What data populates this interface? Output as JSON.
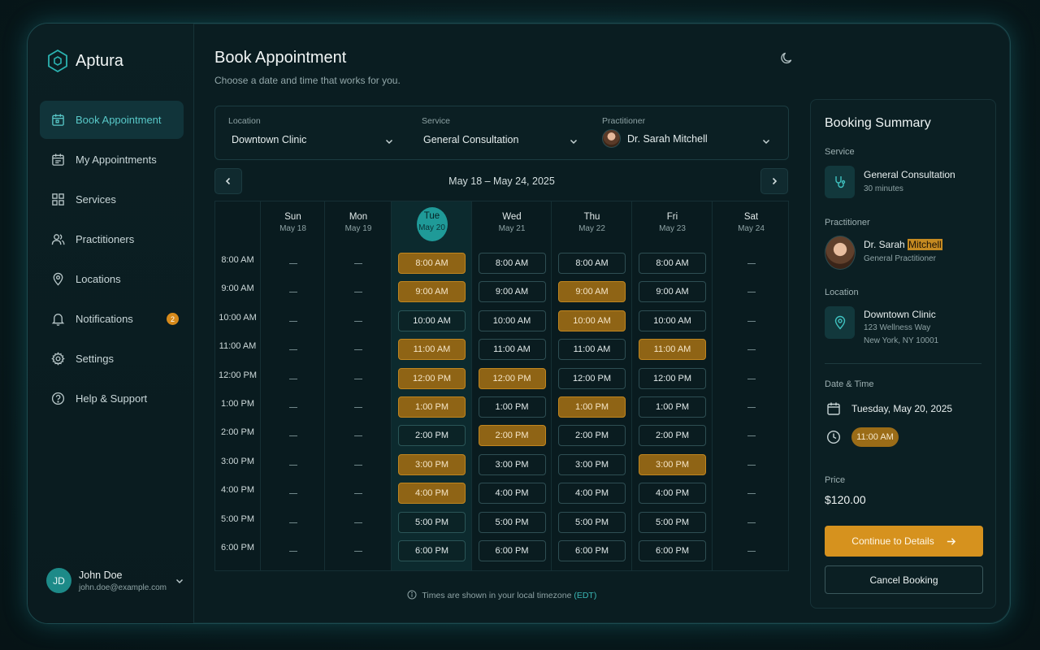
{
  "app": {
    "name": "Aptura"
  },
  "sidebar": {
    "items": [
      {
        "label": "Book Appointment",
        "icon": "calendar-icon",
        "active": true
      },
      {
        "label": "My Appointments",
        "icon": "calendar-check-icon"
      },
      {
        "label": "Services",
        "icon": "grid-icon"
      },
      {
        "label": "Practitioners",
        "icon": "users-icon"
      },
      {
        "label": "Locations",
        "icon": "map-pin-icon"
      },
      {
        "label": "Notifications",
        "icon": "bell-icon",
        "badge": "2"
      },
      {
        "label": "Settings",
        "icon": "gear-icon"
      },
      {
        "label": "Help & Support",
        "icon": "help-circle-icon"
      }
    ],
    "user": {
      "initials": "JD",
      "name": "John Doe",
      "email": "john.doe@example.com"
    }
  },
  "header": {
    "title": "Book Appointment",
    "subtitle": "Choose a date and time that works for you."
  },
  "filters": {
    "location": {
      "label": "Location",
      "value": "Downtown Clinic"
    },
    "service": {
      "label": "Service",
      "value": "General Consultation"
    },
    "practitioner": {
      "label": "Practitioner",
      "value": "Dr. Sarah Mitchell"
    }
  },
  "calendar": {
    "week_label": "May 18 – May 24, 2025",
    "days": [
      {
        "name": "Sun",
        "date": "May 18"
      },
      {
        "name": "Mon",
        "date": "May 19"
      },
      {
        "name": "Tue",
        "date": "May 20",
        "today": true
      },
      {
        "name": "Wed",
        "date": "May 21"
      },
      {
        "name": "Thu",
        "date": "May 22"
      },
      {
        "name": "Fri",
        "date": "May 23"
      },
      {
        "name": "Sat",
        "date": "May 24"
      }
    ],
    "times": [
      "8:00 AM",
      "9:00 AM",
      "10:00 AM",
      "11:00 AM",
      "12:00 PM",
      "1:00 PM",
      "2:00 PM",
      "3:00 PM",
      "4:00 PM",
      "5:00 PM",
      "6:00 PM"
    ],
    "unavailable_symbol": "—",
    "slot_states": {
      "Sun": [
        "x",
        "x",
        "x",
        "x",
        "x",
        "x",
        "x",
        "x",
        "x",
        "x",
        "x"
      ],
      "Mon": [
        "x",
        "x",
        "x",
        "x",
        "x",
        "x",
        "x",
        "x",
        "x",
        "x",
        "x"
      ],
      "Tue": [
        "b",
        "b",
        "a",
        "b",
        "b",
        "b",
        "a",
        "b",
        "b",
        "a",
        "a"
      ],
      "Wed": [
        "a",
        "a",
        "a",
        "a",
        "b",
        "a",
        "b",
        "a",
        "a",
        "a",
        "a"
      ],
      "Thu": [
        "a",
        "b",
        "b",
        "a",
        "a",
        "b",
        "a",
        "a",
        "a",
        "a",
        "a"
      ],
      "Fri": [
        "a",
        "a",
        "a",
        "b",
        "a",
        "a",
        "a",
        "b",
        "a",
        "a",
        "a"
      ],
      "Sat": [
        "x",
        "x",
        "x",
        "x",
        "x",
        "x",
        "x",
        "x",
        "x",
        "x",
        "x"
      ]
    },
    "timezone_note": "Times are shown in your local timezone",
    "timezone": "(EDT)"
  },
  "summary": {
    "title": "Booking Summary",
    "service_label": "Service",
    "service_name": "General Consultation",
    "service_duration": "30 minutes",
    "practitioner_label": "Practitioner",
    "practitioner_name_first": "Dr. Sarah",
    "practitioner_name_last": "Mitchell",
    "practitioner_role": "General Practitioner",
    "location_label": "Location",
    "location_name": "Downtown Clinic",
    "location_address1": "123 Wellness Way",
    "location_address2": "New York, NY 10001",
    "datetime_label": "Date & Time",
    "date": "Tuesday, May 20, 2025",
    "time": "11:00 AM",
    "price_label": "Price",
    "price": "$120.00",
    "continue_label": "Continue to Details",
    "cancel_label": "Cancel Booking"
  },
  "colors": {
    "accent_teal": "#1f9a98",
    "accent_amber": "#d6921e",
    "booked_slot": "#8f6415"
  }
}
